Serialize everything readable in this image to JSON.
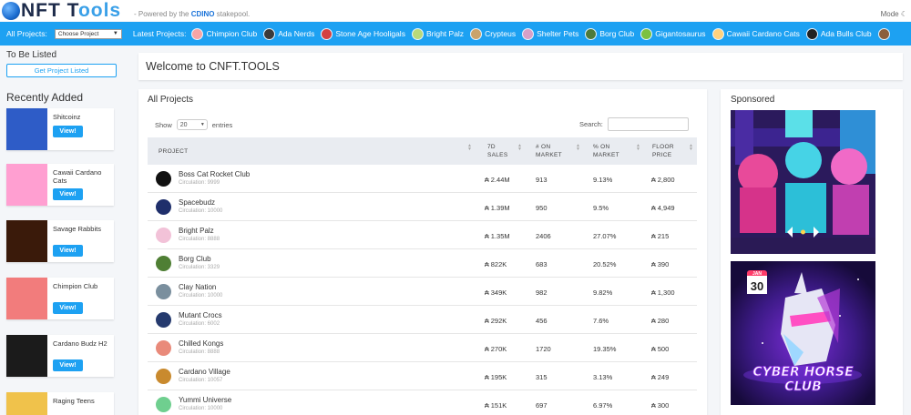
{
  "header": {
    "logo_prefix": "NFT T",
    "logo_suffix": "ools",
    "powered_text": "- Powered by the",
    "powered_brand": "CDINO",
    "powered_tail": "stakepool.",
    "mode_label": "Mode"
  },
  "nav": {
    "all_projects_label": "All Projects:",
    "select_value": "Choose Project",
    "latest_label": "Latest Projects:",
    "latest_projects": [
      {
        "label": "Chimpion Club",
        "color": "#f7a5a5"
      },
      {
        "label": "Ada Nerds",
        "color": "#3b3b3b"
      },
      {
        "label": "Stone Age Hooligals",
        "color": "#d34141"
      },
      {
        "label": "Bright Palz",
        "color": "#b9d97b"
      },
      {
        "label": "Crypteus",
        "color": "#c9a36b"
      },
      {
        "label": "Shelter Pets",
        "color": "#d8a0c8"
      },
      {
        "label": "Borg Club",
        "color": "#4e7a3a"
      },
      {
        "label": "Gigantosaurus",
        "color": "#7bc142"
      },
      {
        "label": "Cawaii Cardano Cats",
        "color": "#ffd27f"
      },
      {
        "label": "Ada Bulls Club",
        "color": "#222222"
      },
      {
        "label": "",
        "color": "#8b5e3c"
      }
    ]
  },
  "sidebar": {
    "to_be_listed": "To Be Listed",
    "get_listed_button": "Get Project Listed",
    "recently_added": "Recently Added",
    "view_label": "View!",
    "recent": [
      {
        "name": "Shitcoinz",
        "bg": "#2e5cc7"
      },
      {
        "name": "Cawaii Cardano Cats",
        "bg": "#ff9fd1"
      },
      {
        "name": "Savage Rabbits",
        "bg": "#3a1a0a"
      },
      {
        "name": "Chimpion Club",
        "bg": "#f27c7c"
      },
      {
        "name": "Cardano Budz H2",
        "bg": "#1b1b1b"
      },
      {
        "name": "Raging Teens",
        "bg": "#f0c24b"
      }
    ]
  },
  "welcome": {
    "title": "Welcome to CNFT.TOOLS"
  },
  "projects": {
    "title": "All Projects",
    "show_label": "Show",
    "entries_value": "20",
    "entries_label": "entries",
    "search_label": "Search:",
    "columns": {
      "project": "PROJECT",
      "sales_1": "7D",
      "sales_2": "SALES",
      "on_market_1": "# ON",
      "on_market_2": "MARKET",
      "pct_market_1": "% ON",
      "pct_market_2": "MARKET",
      "floor_1": "FLOOR",
      "floor_2": "PRICE"
    },
    "currency_symbol": "₳",
    "rows": [
      {
        "name": "Boss Cat Rocket Club",
        "circulation": "Circulation: 9999",
        "sales": "2.44M",
        "on_market": "913",
        "pct": "9.13%",
        "floor": "2,800",
        "color": "#111111"
      },
      {
        "name": "Spacebudz",
        "circulation": "Circulation: 10000",
        "sales": "1.39M",
        "on_market": "950",
        "pct": "9.5%",
        "floor": "4,949",
        "color": "#1f2f6b"
      },
      {
        "name": "Bright Palz",
        "circulation": "Circulation: 8888",
        "sales": "1.35M",
        "on_market": "2406",
        "pct": "27.07%",
        "floor": "215",
        "color": "#f2c2d8"
      },
      {
        "name": "Borg Club",
        "circulation": "Circulation: 3329",
        "sales": "822K",
        "on_market": "683",
        "pct": "20.52%",
        "floor": "390",
        "color": "#4f7f34"
      },
      {
        "name": "Clay Nation",
        "circulation": "Circulation: 10000",
        "sales": "349K",
        "on_market": "982",
        "pct": "9.82%",
        "floor": "1,300",
        "color": "#7a8f9e"
      },
      {
        "name": "Mutant Crocs",
        "circulation": "Circulation: 6002",
        "sales": "292K",
        "on_market": "456",
        "pct": "7.6%",
        "floor": "280",
        "color": "#253a6e"
      },
      {
        "name": "Chilled Kongs",
        "circulation": "Circulation: 8888",
        "sales": "270K",
        "on_market": "1720",
        "pct": "19.35%",
        "floor": "500",
        "color": "#e98a7a"
      },
      {
        "name": "Cardano Village",
        "circulation": "Circulation: 10057",
        "sales": "195K",
        "on_market": "315",
        "pct": "3.13%",
        "floor": "249",
        "color": "#c98a2e"
      },
      {
        "name": "Yummi Universe",
        "circulation": "Circulation: 10000",
        "sales": "151K",
        "on_market": "697",
        "pct": "6.97%",
        "floor": "300",
        "color": "#6fcf8f"
      }
    ]
  },
  "sponsored": {
    "title": "Sponsored",
    "ad2_badge_month": "JAN",
    "ad2_badge_day": "30",
    "ad2_title_1": "CYBER HORSE",
    "ad2_title_2": "CLUB"
  }
}
